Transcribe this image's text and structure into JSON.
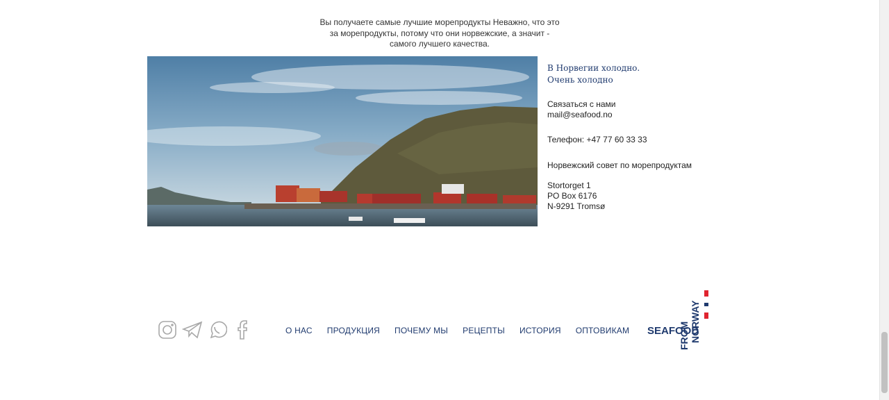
{
  "intro": {
    "text": "Вы получаете самые лучшие морепродукты Неважно, что это\nза морепродукты, потому что они норвежские, а значит -\nсамого лучшего качества."
  },
  "info": {
    "headline": [
      "В Норвегии холодно.",
      "Очень холодно"
    ],
    "contact_label": "Связаться с нами",
    "email": "mail@seafood.no",
    "phone": "Телефон: +47 77 60 33 33",
    "council": "Норвежский совет по морепродуктам",
    "address": [
      "Stortorget 1",
      "PO Box 6176",
      "N-9291 Tromsø"
    ]
  },
  "social": [
    "instagram-icon",
    "telegram-icon",
    "whatsapp-icon",
    "facebook-icon"
  ],
  "nav": [
    "О НАС",
    "ПРОДУКЦИЯ",
    "ПОЧЕМУ МЫ",
    "РЕЦЕПТЫ",
    "ИСТОРИЯ",
    "ОПТОВИКАМ"
  ],
  "logo": {
    "word_seafood": "SEAFOOD",
    "word_from": "FROM",
    "word_norway": "NORWAY"
  },
  "colors": {
    "navy": "#1f3a6e",
    "red": "#e0242f",
    "icon_gray": "#a8a8a8"
  }
}
